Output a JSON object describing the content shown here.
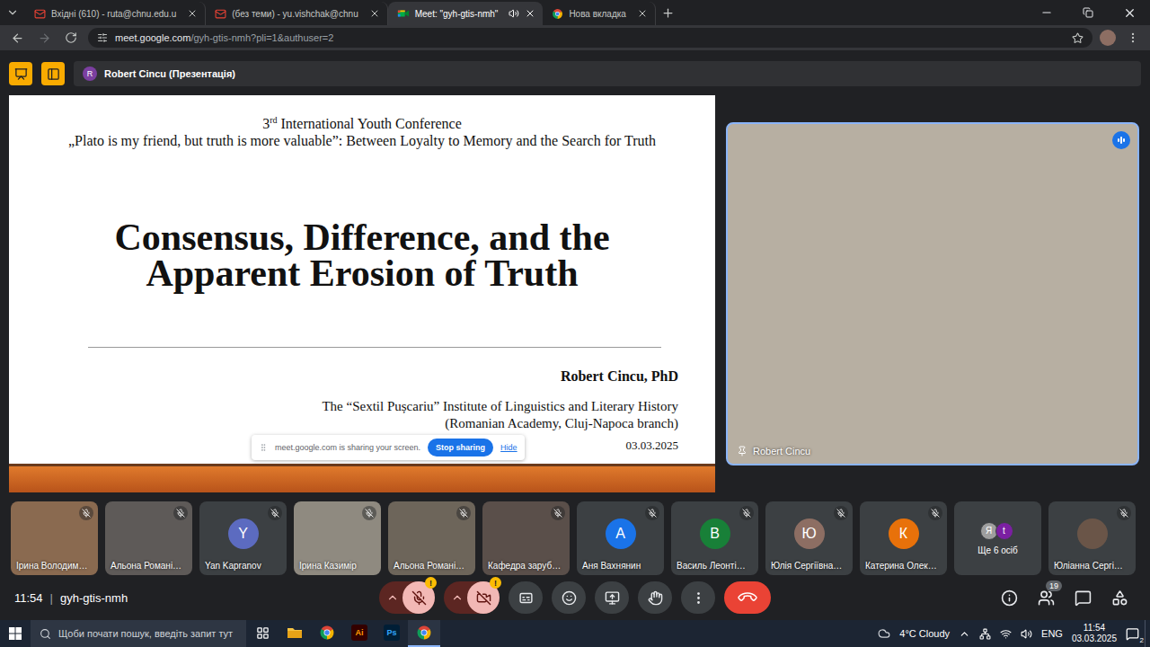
{
  "browser": {
    "tabs": [
      {
        "title": "Вхідні (610) - ruta@chnu.edu.u",
        "favicon": "gmail",
        "selected": false,
        "audio": false
      },
      {
        "title": "(без теми) - yu.vishchak@chnu",
        "favicon": "gmail",
        "selected": false,
        "audio": false
      },
      {
        "title": "Meet: \"gyh-gtis-nmh\"",
        "favicon": "meet",
        "selected": true,
        "audio": true
      },
      {
        "title": "Нова вкладка",
        "favicon": "chrome",
        "selected": false,
        "audio": false
      }
    ],
    "navigation": {
      "back_enabled": true,
      "forward_enabled": false
    },
    "address": {
      "host": "meet.google.com",
      "path": "/gyh-gtis-nmh?pli=1&authuser=2",
      "bookmarked": false
    }
  },
  "meet": {
    "presenter_bar": {
      "avatar": "R",
      "color": "#7b3fa0",
      "label": "Robert Cincu (Презентація)"
    },
    "slide": {
      "ordinal": "3",
      "ordinal_suffix": "rd",
      "conference": "International Youth Conference",
      "subtitle": "„Plato is my friend, but truth is more valuable”: Between Loyalty to Memory and the Search for Truth",
      "title_lines": [
        "Consensus, Difference, and the",
        "Apparent Erosion of Truth"
      ],
      "author": "Robert Cincu, PhD",
      "affiliation": [
        "The “Sextil Pușcariu” Institute of Linguistics and Literary History",
        "(Romanian Academy, Cluj-Napoca branch)"
      ],
      "date": "03.03.2025"
    },
    "sharing_notice": {
      "text": "meet.google.com is sharing your screen.",
      "stop": "Stop sharing",
      "hide": "Hide"
    },
    "speaker": {
      "name": "Robert Cincu",
      "pinned": true,
      "speaking": true
    },
    "participants": [
      {
        "name": "Ірина Володим…",
        "kind": "video",
        "color": "#8a6a50",
        "muted": true
      },
      {
        "name": "Альона Романі…",
        "kind": "video",
        "color": "#5e5a58",
        "muted": true
      },
      {
        "name": "Yan Kapranov",
        "kind": "avatar",
        "avatar": "Y",
        "color": "#5c6bc0",
        "muted": true
      },
      {
        "name": "Ірина Казимір",
        "kind": "video",
        "color": "#8f8a80",
        "muted": true
      },
      {
        "name": "Альона Романі…",
        "kind": "video",
        "color": "#6d655a",
        "muted": true
      },
      {
        "name": "Кафедра заруб…",
        "kind": "video",
        "color": "#5a4f4a",
        "muted": true
      },
      {
        "name": "Аня Вахнянин",
        "kind": "avatar",
        "avatar": "А",
        "color": "#1a73e8",
        "muted": true
      },
      {
        "name": "Василь Леонті…",
        "kind": "avatar",
        "avatar": "В",
        "color": "#188038",
        "muted": true
      },
      {
        "name": "Юлія Сергіївна…",
        "kind": "avatar",
        "avatar": "Ю",
        "color": "#8d6e63",
        "muted": true
      },
      {
        "name": "Катерина Олек…",
        "kind": "avatar",
        "avatar": "К",
        "color": "#e8710a",
        "muted": true
      },
      {
        "name": "Ще 6 осіб",
        "kind": "group",
        "members": [
          {
            "avatar": "Я",
            "color": "#9e9e9e"
          },
          {
            "avatar": "t",
            "color": "#7b1fa2"
          }
        ]
      },
      {
        "name": "Юліанна Сергі…",
        "kind": "picture",
        "color": "#6a5548",
        "muted": true
      }
    ],
    "call": {
      "time": "11:54",
      "separator": "|",
      "code": "gyh-gtis-nmh"
    },
    "controls": [
      {
        "kind": "microphone",
        "on": false,
        "alert": "!"
      },
      {
        "kind": "camera",
        "on": false,
        "alert": "!"
      },
      {
        "kind": "captions"
      },
      {
        "kind": "reactions"
      },
      {
        "kind": "present"
      },
      {
        "kind": "raise-hand"
      },
      {
        "kind": "more"
      },
      {
        "kind": "leave"
      }
    ],
    "side_buttons": [
      {
        "kind": "info"
      },
      {
        "kind": "people",
        "badge": "19"
      },
      {
        "kind": "chat"
      },
      {
        "kind": "activities"
      }
    ]
  },
  "taskbar": {
    "search_placeholder": "Щоби почати пошук, введіть запит тут",
    "apps": [
      {
        "kind": "explorer",
        "active": false
      },
      {
        "kind": "chrome",
        "active": false
      },
      {
        "kind": "illustrator",
        "label": "Ai",
        "active": false
      },
      {
        "kind": "photoshop",
        "label": "Ps",
        "active": false
      },
      {
        "kind": "chrome",
        "active": true
      }
    ],
    "weather": {
      "temp": "4°C",
      "text": "Cloudy"
    },
    "language": "ENG",
    "time": "11:54",
    "date": "03.03.2025",
    "notifications": "2"
  }
}
